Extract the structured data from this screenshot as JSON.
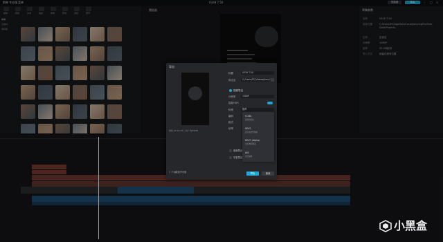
{
  "app": {
    "logo_text": "剪映 专业版",
    "menu_label": "菜单",
    "project_title": "0328 7.50",
    "shortcut_label": "快捷键",
    "export_label": "导出"
  },
  "media_panel": {
    "tools": [
      "媒体",
      "音频",
      "文本",
      "贴纸",
      "特效",
      "转场",
      "滤镜",
      "调节"
    ],
    "sidebar": [
      "本地",
      "云素材",
      "素材库"
    ],
    "active_tab": "素材库"
  },
  "viewer": {
    "title": "播放器"
  },
  "properties": {
    "title": "草稿参数",
    "fields": [
      {
        "label": "名称",
        "value": "0328 7.50"
      },
      {
        "label": "保存位置",
        "value": "C:/Users/PC/AppData/Local/JianyingPro/User Data/Projects"
      },
      {
        "label": "比例",
        "value": "自适应"
      },
      {
        "label": "分辨率",
        "value": "1080P"
      },
      {
        "label": "帧率",
        "value": "30.00帧/秒"
      },
      {
        "label": "导入方式",
        "value": "保留在原有位置"
      }
    ]
  },
  "export_dialog": {
    "title": "导出",
    "name_label": "标题",
    "name_value": "0328 7.50",
    "path_label": "导出至",
    "path_value": "C:/Users/PC/Videos/JianyingPro",
    "video_section": "视频导出",
    "rows": [
      {
        "label": "分辨率",
        "value": "1080P"
      },
      {
        "label": "码率",
        "value": "推荐"
      },
      {
        "label": "编码",
        "value": "H.264"
      },
      {
        "label": "格式",
        "value": "mp4"
      },
      {
        "label": "帧率",
        "value": "30fps"
      }
    ],
    "smart_hdr_label": "智能HDR",
    "audio_section": "音频导出",
    "caption_section": "字幕导出",
    "footer_hint": "1 个功能暂不可用",
    "preview_caption": "时长 00:00:35 | 大小 约35MB",
    "export_button": "导出",
    "cancel_button": "取消",
    "dropdown_options": [
      {
        "title": "H.264",
        "sub": "兼容性最好"
      },
      {
        "title": "HEVC",
        "sub": "更小的文件体积"
      },
      {
        "title": "HEVC (Alpha)",
        "sub": "支持透明通道"
      },
      {
        "title": "AV1",
        "sub": "高压缩率"
      }
    ]
  },
  "watermark": {
    "text": "小黑盒"
  },
  "colors": {
    "accent": "#1ea7d0",
    "track_red": "#7a3a32",
    "track_blue": "#1f4f73",
    "bg": "#111214"
  }
}
